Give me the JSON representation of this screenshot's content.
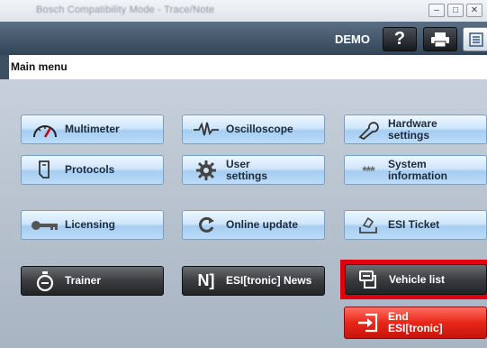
{
  "window": {
    "title": "Bosch Compatibility Mode - Trace/Note",
    "controls": {
      "minimize": "–",
      "maximize": "□",
      "close": "✕"
    }
  },
  "header": {
    "demo_label": "DEMO",
    "icons": [
      "help-icon",
      "print-icon",
      "list-icon"
    ]
  },
  "menu": {
    "title": "Main menu"
  },
  "buttons": {
    "multimeter": "Multimeter",
    "oscilloscope": "Oscilloscope",
    "hardware_settings_1": "Hardware",
    "hardware_settings_2": "settings",
    "protocols": "Protocols",
    "user_settings_1": "User",
    "user_settings_2": "settings",
    "system_information_1": "System",
    "system_information_2": "information",
    "licensing": "Licensing",
    "online_update": "Online update",
    "esi_ticket": "ESI Ticket",
    "trainer": "Trainer",
    "esi_news": "ESI[tronic] News",
    "vehicle_list": "Vehicle list",
    "end_1": "End",
    "end_2": "ESI[tronic]"
  },
  "colors": {
    "highlight": "#e0000d",
    "header": "#3d5063",
    "button_blue": "#bcdcf8",
    "button_dark": "#2f3133",
    "button_red": "#e8261a"
  }
}
